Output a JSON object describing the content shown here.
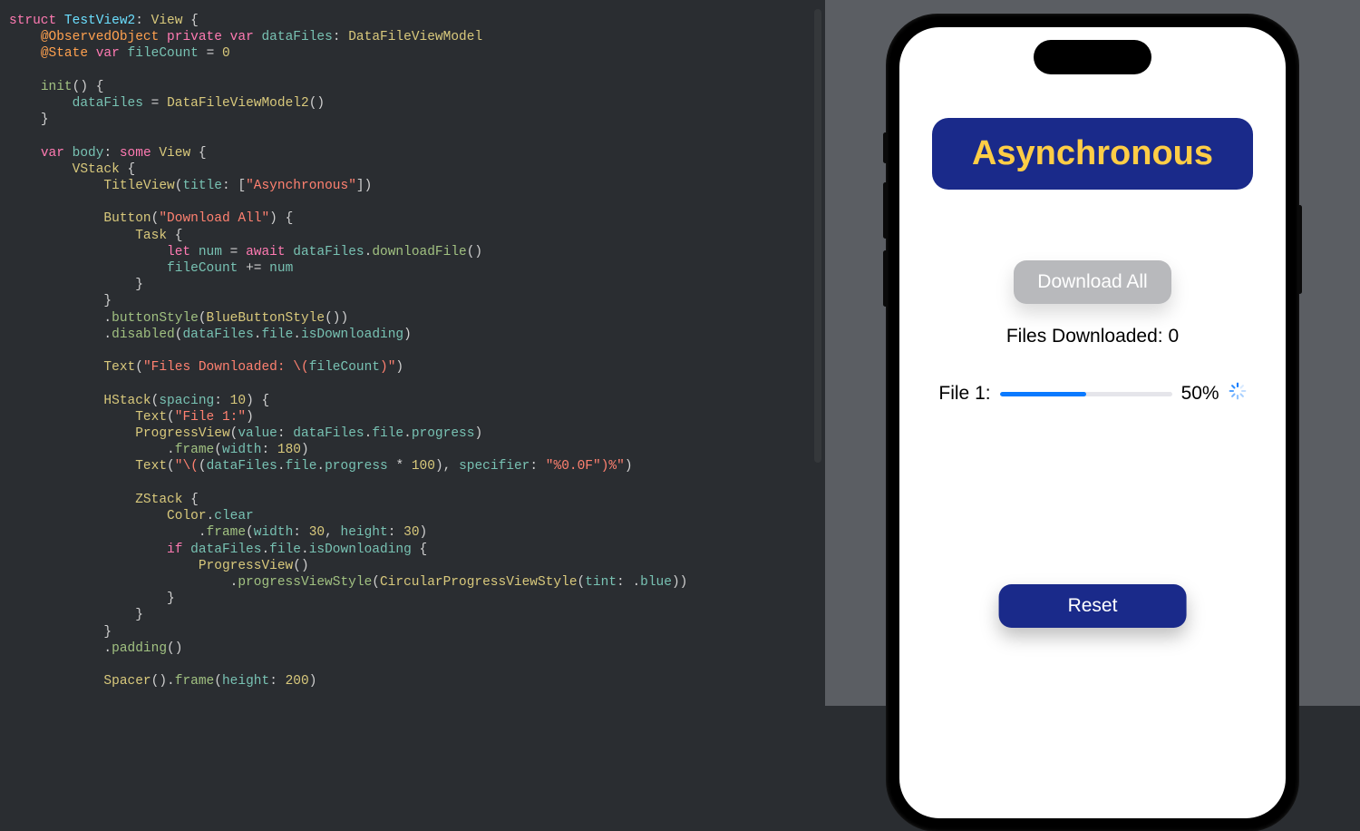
{
  "code": {
    "structName": "TestView2",
    "viewModelType": "DataFileViewModel",
    "viewModelType2": "DataFileViewModel2",
    "dataFilesVar": "dataFiles",
    "fileCountVar": "fileCount",
    "fileCountInit": "0",
    "titleString": "Asynchronous",
    "downloadAllLabel": "Download All",
    "filesDownloadedPrefix": "Files Downloaded: ",
    "hstackSpacing": "10",
    "file1Label": "File 1:",
    "progressFrameWidth": "180",
    "percentMult": "100",
    "specifier": "%0.0F",
    "zstackW": "30",
    "zstackH": "30",
    "spacerHeight": "200"
  },
  "preview": {
    "title": "Asynchronous",
    "downloadButton": "Download All",
    "filesDownloadedLabel": "Files Downloaded: ",
    "filesDownloadedCount": "0",
    "file1Label": "File 1:",
    "progressPercent": 50,
    "progressText": "50%",
    "resetButton": "Reset"
  },
  "colors": {
    "accentBlue": "#1a2a8a",
    "accentYellow": "#fecd46",
    "iosBlue": "#0a7aff"
  }
}
